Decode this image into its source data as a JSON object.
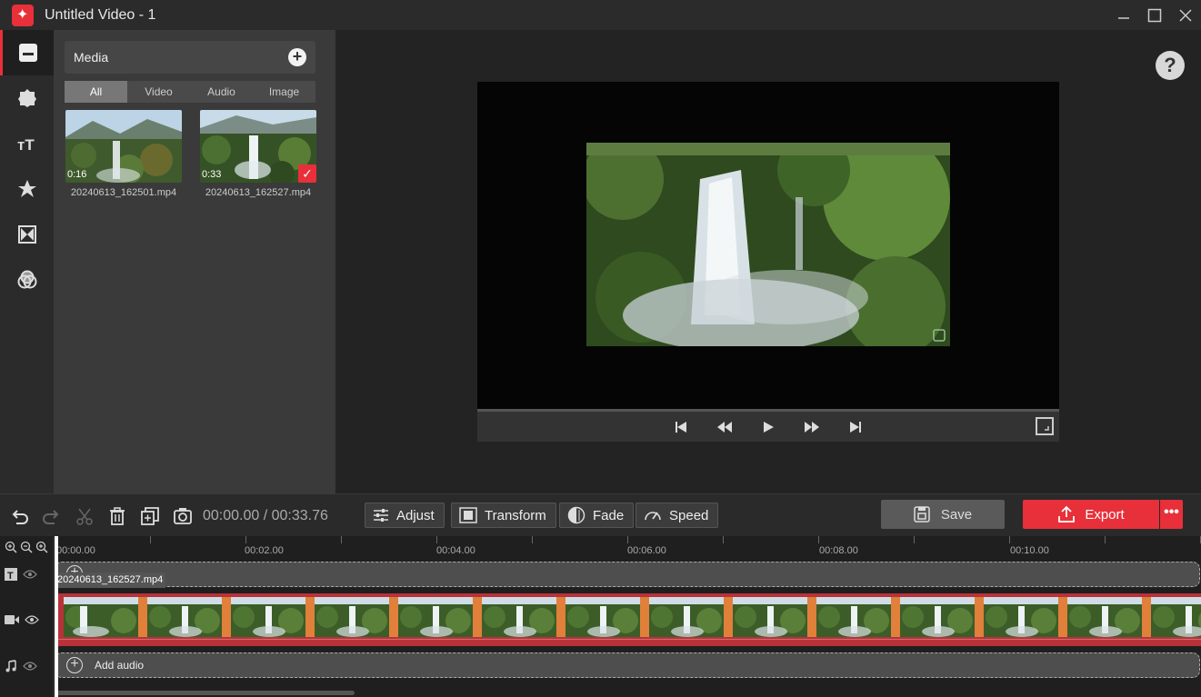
{
  "window": {
    "title": "Untitled Video - 1"
  },
  "sidebar": {
    "items": [
      {
        "icon": "media-icon",
        "active": true
      },
      {
        "icon": "effects-icon",
        "active": false
      },
      {
        "icon": "text-icon",
        "active": false
      },
      {
        "icon": "sticker-icon",
        "active": false
      },
      {
        "icon": "transition-icon",
        "active": false
      },
      {
        "icon": "filter-icon",
        "active": false
      }
    ]
  },
  "media": {
    "title": "Media",
    "tabs": [
      "All",
      "Video",
      "Audio",
      "Image"
    ],
    "active_tab": "All",
    "items": [
      {
        "name": "20240613_162501.mp4",
        "duration": "0:16",
        "selected": false
      },
      {
        "name": "20240613_162527.mp4",
        "duration": "0:33",
        "selected": true
      }
    ]
  },
  "toolbar": {
    "timecode": "00:00.00 / 00:33.76",
    "adjust": "Adjust",
    "transform": "Transform",
    "fade": "Fade",
    "speed": "Speed",
    "save": "Save",
    "export": "Export"
  },
  "timeline": {
    "ruler": [
      "00:00.00",
      "00:02.00",
      "00:04.00",
      "00:06.00",
      "00:08.00",
      "00:10.00"
    ],
    "clip_name": "20240613_162527.mp4",
    "add_audio": "Add audio"
  },
  "colors": {
    "accent": "#e8303a",
    "clip_border": "#b8323a",
    "frame_separator": "#e0803a"
  }
}
